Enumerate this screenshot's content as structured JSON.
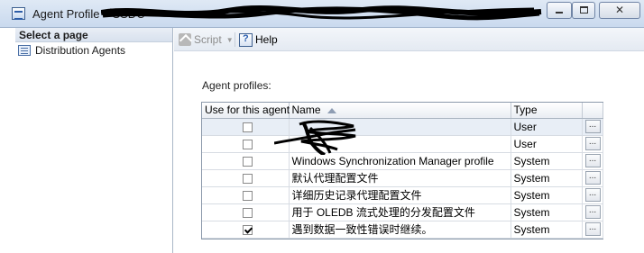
{
  "window": {
    "title": "Agent Profile - 'SSDC",
    "minimize_icon": "minimize-icon",
    "maximize_icon": "maximize-icon",
    "close_label": "✕"
  },
  "sidebar": {
    "header": "Select a page",
    "items": [
      {
        "label": "Distribution Agents",
        "icon": "page-icon"
      }
    ]
  },
  "toolbar": {
    "script_label": "Script",
    "help_label": "Help"
  },
  "main": {
    "profiles_label": "Agent profiles:",
    "columns": [
      "Use for this agent",
      "Name",
      "Type",
      ""
    ],
    "rows": [
      {
        "checked": false,
        "name": "",
        "type": "User"
      },
      {
        "checked": false,
        "name": "",
        "type": "User"
      },
      {
        "checked": false,
        "name": "Windows Synchronization Manager profile",
        "type": "System"
      },
      {
        "checked": false,
        "name": "默认代理配置文件",
        "type": "System"
      },
      {
        "checked": false,
        "name": "详细历史记录代理配置文件",
        "type": "System"
      },
      {
        "checked": false,
        "name": "用于 OLEDB 流式处理的分发配置文件",
        "type": "System"
      },
      {
        "checked": true,
        "name": "遇到数据一致性错误时继续。",
        "type": "System"
      }
    ],
    "row_button_label": "..."
  },
  "colors": {
    "titlebar": "#c9d9ee",
    "selected_row": "#e8eef6",
    "redaction": "#000000"
  }
}
